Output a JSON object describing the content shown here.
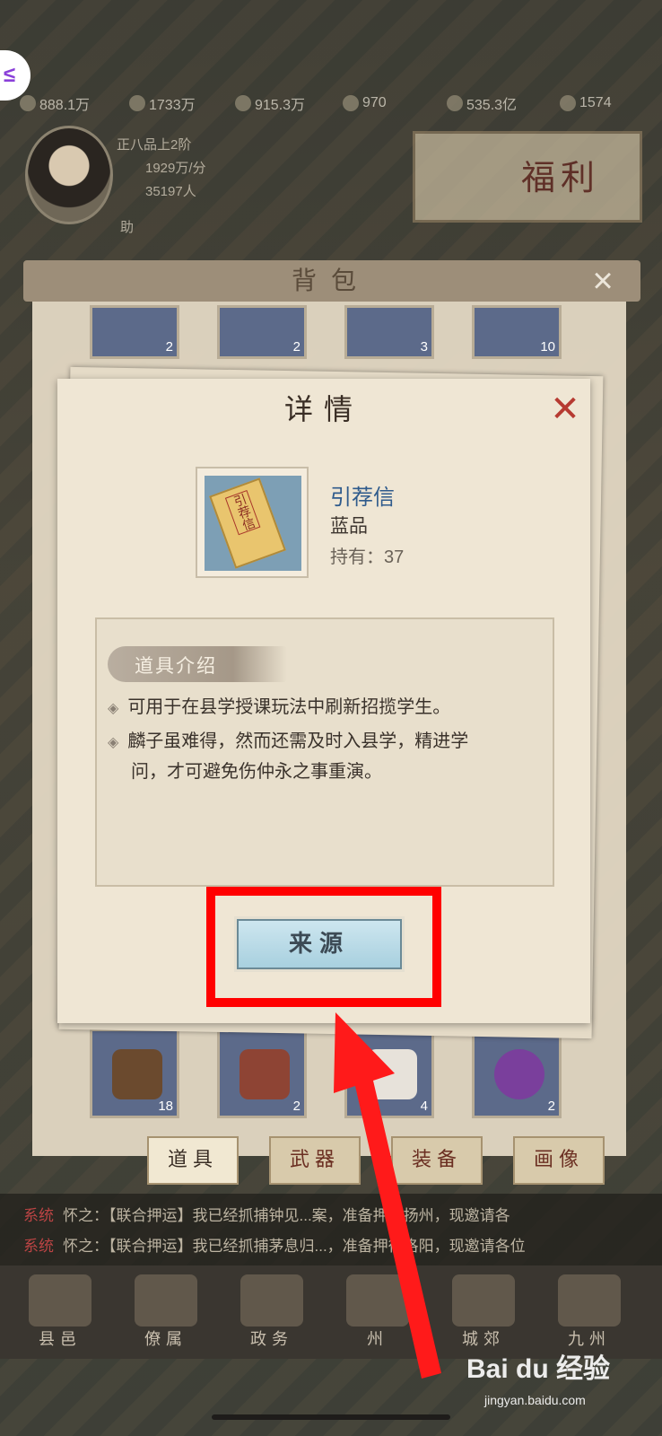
{
  "resources": [
    "888.1万",
    "1733万",
    "915.3万",
    "970",
    "535.3亿",
    "1574"
  ],
  "player": {
    "rank": "正八品上2阶",
    "income": "1929万/分",
    "population": "35197人",
    "help": "助"
  },
  "welfare": {
    "label": "福利"
  },
  "bag": {
    "title": "背包",
    "close_icon": "×",
    "top_row_counts": [
      "2",
      "2",
      "3",
      "10"
    ],
    "bottom_row_counts": [
      "18",
      "2",
      "4",
      "2"
    ],
    "tabs": [
      {
        "label": "道具",
        "active": true
      },
      {
        "label": "武器",
        "active": false
      },
      {
        "label": "装备",
        "active": false
      },
      {
        "label": "画像",
        "active": false
      }
    ]
  },
  "detail": {
    "title": "详情",
    "close_icon": "✕",
    "item_name": "引荐信",
    "item_grade": "蓝品",
    "item_owned": "持有：37",
    "letter_text": "引荐信",
    "section_label": "道具介绍",
    "bullets": [
      "可用于在县学授课玩法中刷新招揽学生。",
      "麟子虽难得，然而还需及时入县学，精进学",
      "问，才可避免伤仲永之事重演。"
    ],
    "source_button": "来源"
  },
  "chat": {
    "lines": [
      {
        "tag": "系统",
        "text": "怀之：【联合押运】我已经抓捕钟见...案，准备押往扬州，现邀请各"
      },
      {
        "tag": "系统",
        "text": "怀之：【联合押运】我已经抓捕茅息归...，准备押往洛阳，现邀请各位"
      }
    ]
  },
  "nav": [
    {
      "label": "县邑"
    },
    {
      "label": "僚属"
    },
    {
      "label": "政务"
    },
    {
      "label": "州"
    },
    {
      "label": "城郊"
    },
    {
      "label": "九州"
    }
  ],
  "watermark": {
    "brand": "Bai du 经验",
    "url": "jingyan.baidu.com"
  },
  "colors": {
    "highlight_red": "#ff0000",
    "item_name_blue": "#2f5b8c",
    "source_button": "#b7dbe7"
  }
}
